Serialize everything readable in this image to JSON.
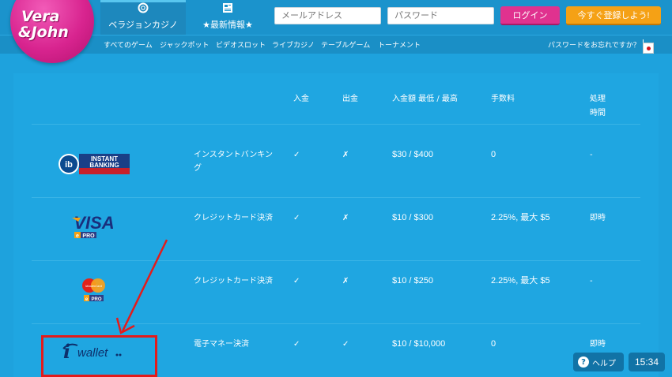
{
  "brand": {
    "logo_line1": "Vera",
    "logo_line2": "&John"
  },
  "header": {
    "tabs": [
      {
        "label": "ベラジョンカジノ",
        "icon": "lifebuoy-icon",
        "active": true
      },
      {
        "label": "★最新情報★",
        "icon": "news-icon",
        "active": false
      }
    ],
    "email_placeholder": "メールアドレス",
    "password_placeholder": "パスワード",
    "login_label": "ログイン",
    "register_label": "今すぐ登録しよう!"
  },
  "nav": {
    "items": [
      "すべてのゲーム",
      "ジャックポット",
      "ビデオスロット",
      "ライブカジノ",
      "テーブルゲーム",
      "トーナメント"
    ],
    "forgot_password": "パスワードをお忘れですか？"
  },
  "payments": {
    "headers": {
      "deposit": "入金",
      "withdraw": "出金",
      "limits": "入金額 最低 / 最高",
      "fee": "手数料",
      "time_line1": "処理",
      "time_line2": "時間"
    },
    "rows": [
      {
        "logo": "instant-banking-logo",
        "logo_text": "INSTANT BANKING",
        "type_line1": "インスタントバンキン",
        "type_line2": "グ",
        "deposit": "✓",
        "withdraw": "✗",
        "limits": "$30 / $400",
        "fee": "0",
        "time": "-"
      },
      {
        "logo": "visa-logo",
        "logo_text": "VISA",
        "type_line1": "クレジットカード決済",
        "type_line2": "",
        "deposit": "✓",
        "withdraw": "✗",
        "limits": "$10 / $300",
        "fee": "2.25%, 最大 $5",
        "time": "即時"
      },
      {
        "logo": "mastercard-logo",
        "logo_text": "MasterCard",
        "type_line1": "クレジットカード決済",
        "type_line2": "",
        "deposit": "✓",
        "withdraw": "✗",
        "limits": "$10 / $250",
        "fee": "2.25%, 最大 $5",
        "time": "-"
      },
      {
        "logo": "iwallet-logo",
        "logo_text": "wallet",
        "type_line1": "電子マネー決済",
        "type_line2": "",
        "deposit": "✓",
        "withdraw": "✓",
        "limits": "$10 / $10,000",
        "fee": "0",
        "time": "即時"
      }
    ],
    "epro_label": "PRO"
  },
  "footer": {
    "help_label": "ヘルプ",
    "help_icon": "question-icon",
    "clock": "15:34"
  },
  "colors": {
    "background": "#1ea2dd",
    "login": "#e0328f",
    "register": "#f5a115",
    "highlight": "#e31b1b",
    "logo_pink": "#d8248f"
  }
}
